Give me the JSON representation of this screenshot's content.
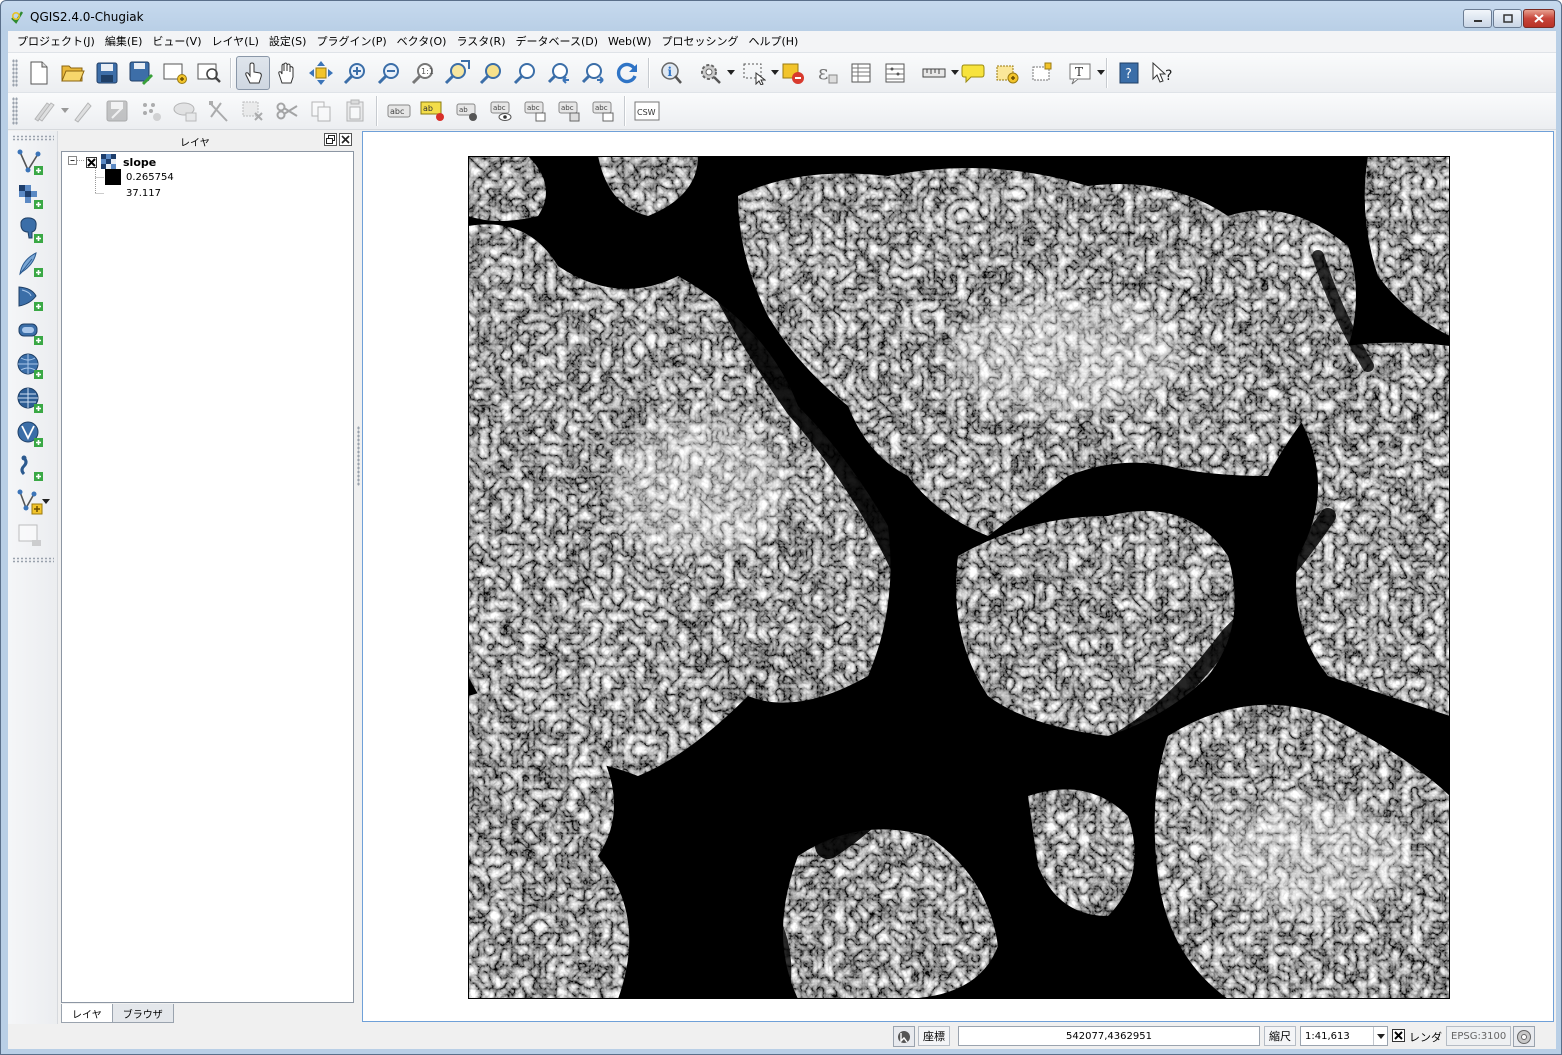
{
  "window": {
    "title": "QGIS2.4.0-Chugiak",
    "controls": [
      "minimize",
      "maximize",
      "close"
    ]
  },
  "menubar": {
    "items": [
      {
        "label": "プロジェクト(J)"
      },
      {
        "label": "編集(E)"
      },
      {
        "label": "ビュー(V)"
      },
      {
        "label": "レイヤ(L)"
      },
      {
        "label": "設定(S)"
      },
      {
        "label": "プラグイン(P)"
      },
      {
        "label": "ベクタ(O)"
      },
      {
        "label": "ラスタ(R)"
      },
      {
        "label": "データベース(D)"
      },
      {
        "label": "Web(W)"
      },
      {
        "label": "プロセッシング"
      },
      {
        "label": "ヘルプ(H)"
      }
    ]
  },
  "toolbar_icons": {
    "row1": [
      "new-project",
      "open-project",
      "save-project",
      "save-as",
      "new-print-composer",
      "composer-manager",
      "touch-zoom-pan",
      "pan-map",
      "pan-to-selection",
      "zoom-in",
      "zoom-out",
      "zoom-actual-size",
      "zoom-full",
      "zoom-to-selection",
      "zoom-to-layer",
      "zoom-last",
      "zoom-next",
      "refresh",
      "identify-features",
      "run-feature-action",
      "select-features",
      "deselect-all",
      "field-calculator",
      "attribute-table",
      "statistical-summary",
      "measure-line",
      "map-tips",
      "new-bookmark",
      "show-bookmarks",
      "text-annotation",
      "help-contents",
      "whats-this"
    ],
    "row2": [
      "current-edits",
      "toggle-editing",
      "save-layer-edits",
      "add-feature",
      "move-feature",
      "node-tool",
      "delete-selected",
      "cut-features",
      "copy-features",
      "paste-features",
      "label-tool",
      "pin-labels",
      "show-hide-labels",
      "move-label",
      "rotate-label",
      "change-label",
      "csw-search"
    ]
  },
  "left_toolbar_icons": [
    "add-vector-layer",
    "add-raster-layer",
    "add-postgis-layer",
    "add-spatialite-layer",
    "add-mssql-layer",
    "add-oracle-layer",
    "add-wms-layer",
    "add-wcs-layer",
    "add-wfs-layer",
    "add-delimited-text-layer",
    "new-shapefile-layer",
    "remove-layer"
  ],
  "layers_panel": {
    "title": "レイヤ",
    "layers": [
      {
        "name": "slope",
        "checked": true,
        "expanded": true,
        "legend": [
          {
            "label": "0.265754",
            "color": "#000000"
          },
          {
            "label": "37.117",
            "color": "#ffffff"
          }
        ]
      }
    ],
    "tabs": [
      {
        "label": "レイヤ",
        "active": true
      },
      {
        "label": "ブラウザ",
        "active": false
      }
    ]
  },
  "statusbar": {
    "coordinate_label": "座標",
    "coordinate_value": "542077,4362951",
    "scale_label": "縮尺",
    "scale_value": "1:41,613",
    "render_label": "レンダ",
    "crs": "EPSG:3100"
  }
}
